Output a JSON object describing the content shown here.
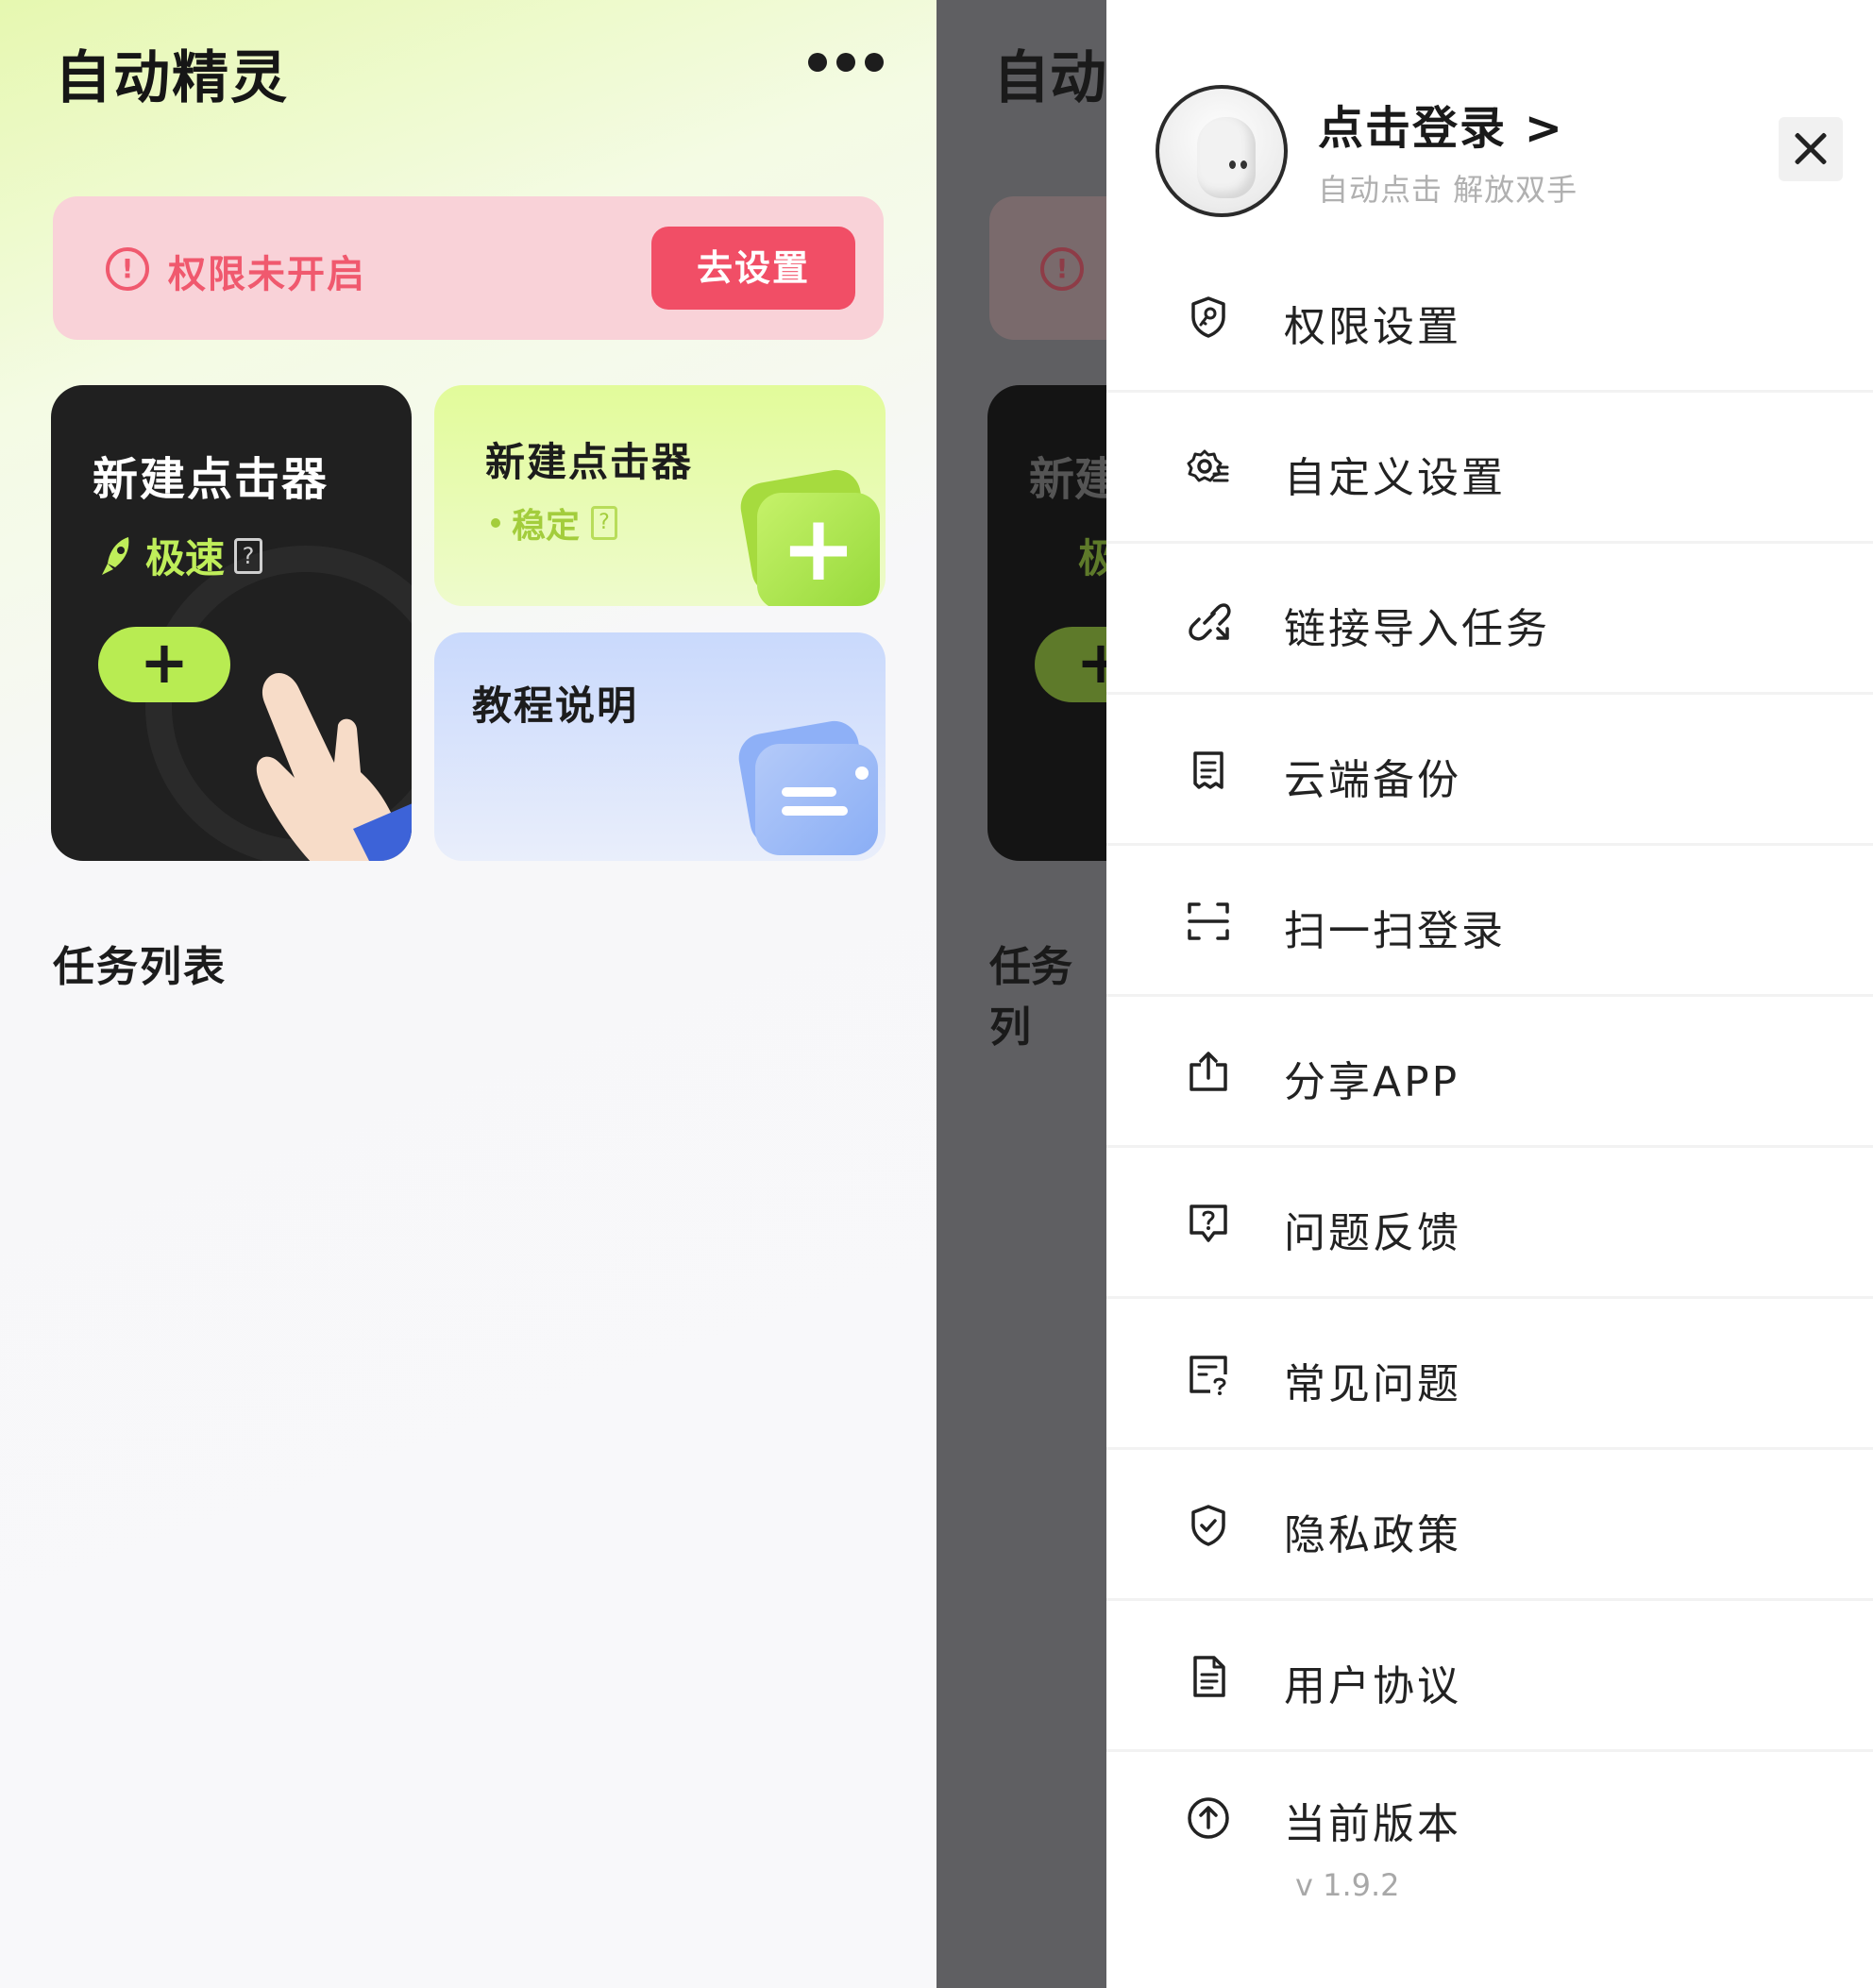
{
  "app": {
    "title": "自动精灵"
  },
  "permission": {
    "text": "权限未开启",
    "button": "去设置"
  },
  "cards": {
    "fast": {
      "title": "新建点击器",
      "mode": "极速"
    },
    "stable": {
      "title": "新建点击器",
      "mode": "稳定"
    },
    "tutorial": {
      "title": "教程说明"
    }
  },
  "tasks": {
    "title": "任务列表"
  },
  "dim_fragments": {
    "title": "自动",
    "card": "新建",
    "speed": "极",
    "tasks": "任务列"
  },
  "drawer": {
    "login": "点击登录 >",
    "subtitle": "自动点击 解放双手",
    "menu": [
      {
        "label": "权限设置",
        "icon": "shield-key-icon"
      },
      {
        "label": "自定义设置",
        "icon": "gear-list-icon"
      },
      {
        "label": "链接导入任务",
        "icon": "link-import-icon"
      },
      {
        "label": "云端备份",
        "icon": "cloud-backup-icon"
      },
      {
        "label": "扫一扫登录",
        "icon": "scan-icon"
      },
      {
        "label": "分享APP",
        "icon": "share-icon"
      },
      {
        "label": "问题反馈",
        "icon": "feedback-icon"
      },
      {
        "label": "常见问题",
        "icon": "faq-icon"
      },
      {
        "label": "隐私政策",
        "icon": "privacy-shield-icon"
      },
      {
        "label": "用户协议",
        "icon": "document-icon"
      },
      {
        "label": "当前版本",
        "icon": "upgrade-icon",
        "sub": "v 1.9.2"
      }
    ]
  },
  "colors": {
    "accent_red": "#f14e66",
    "accent_green": "#b8ec52",
    "dark_card": "#202020",
    "overlay": "#5f5f62"
  }
}
